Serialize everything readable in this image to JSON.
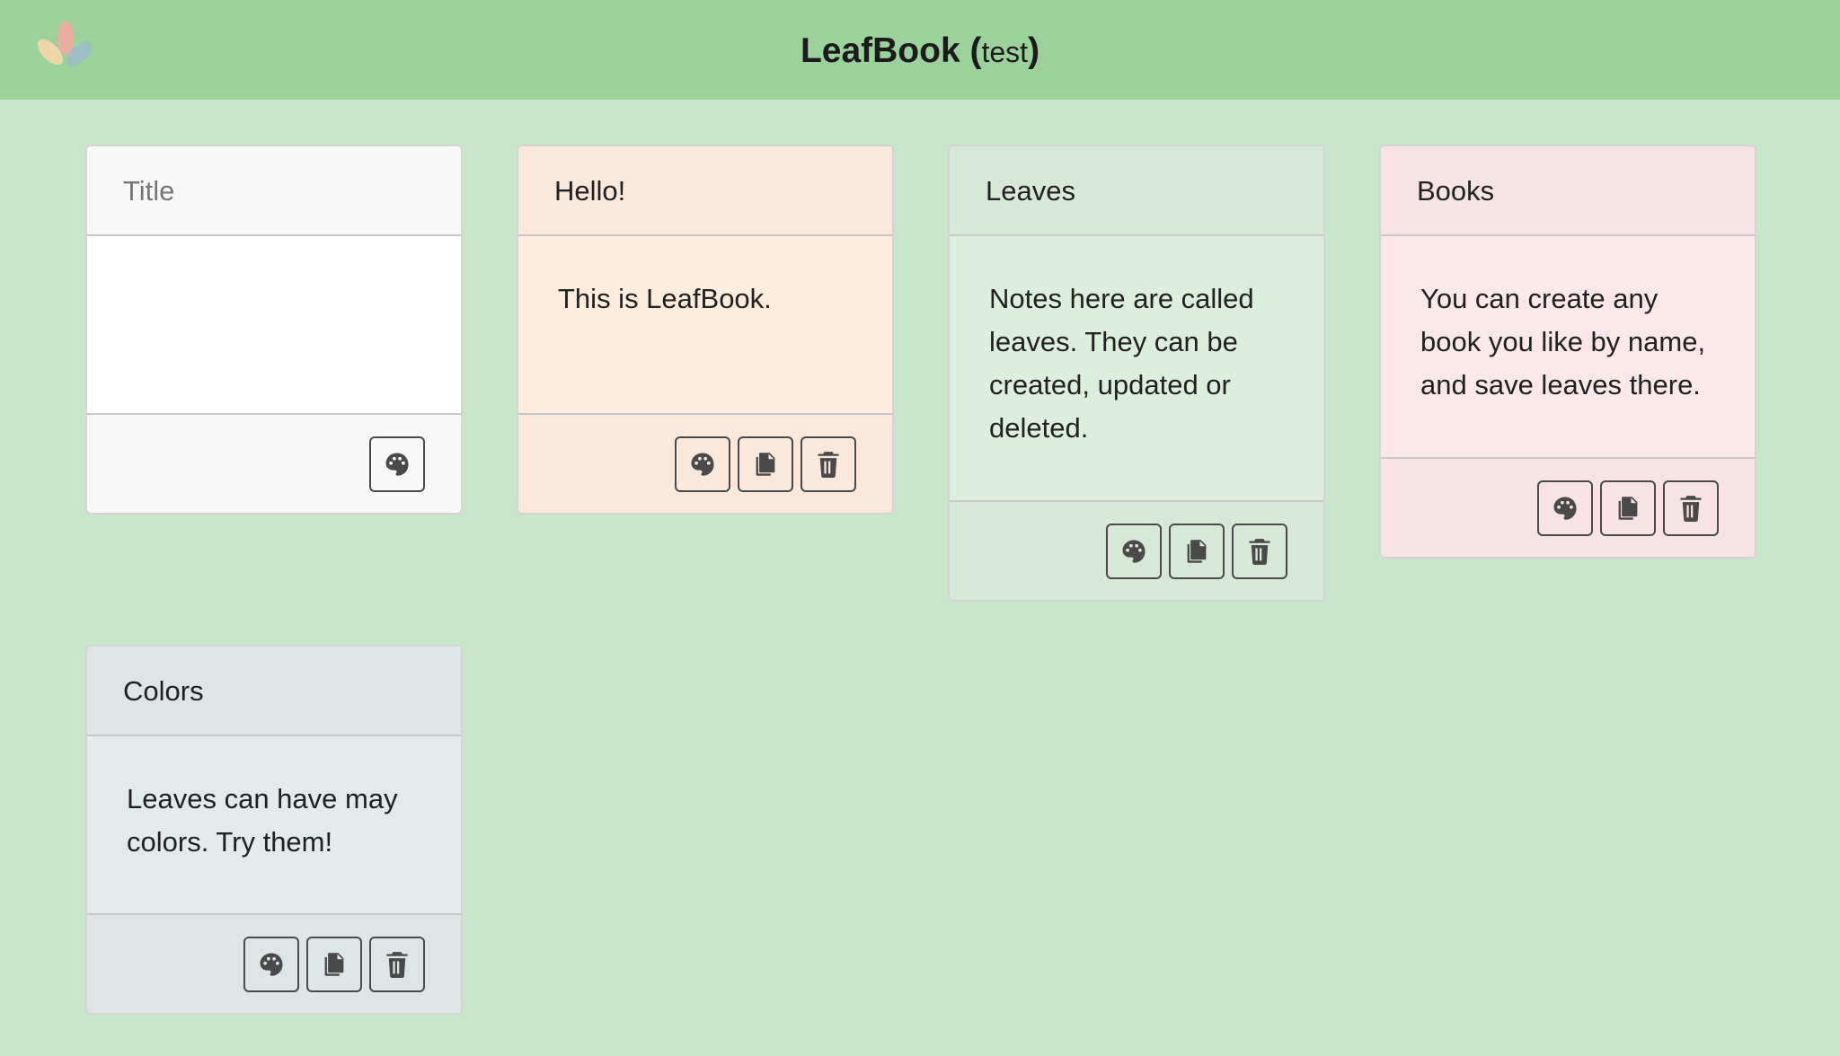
{
  "app": {
    "name": "LeafBook",
    "open_paren": "(",
    "mode": "test",
    "close_paren": ")"
  },
  "icons": {
    "logo": "leaf-logo-icon",
    "color": "palette-icon",
    "copy": "copy-icon",
    "delete": "trash-icon"
  },
  "colors": {
    "header": "#9bd29c",
    "background": "#c8e6c9",
    "icon": "#4a4a4a"
  },
  "new_leaf": {
    "title_placeholder": "Title",
    "body_value": ""
  },
  "leaves": [
    {
      "title": "Hello!",
      "body": "This is LeafBook.",
      "color": "orange"
    },
    {
      "title": "Leaves",
      "body": "Notes here are called leaves. They can be created, updated or deleted.",
      "color": "green"
    },
    {
      "title": "Books",
      "body": "You can create any book you like by name, and save leaves there.",
      "color": "pink"
    },
    {
      "title": "Colors",
      "body": "Leaves can have may colors. Try them!",
      "color": "gray"
    }
  ]
}
